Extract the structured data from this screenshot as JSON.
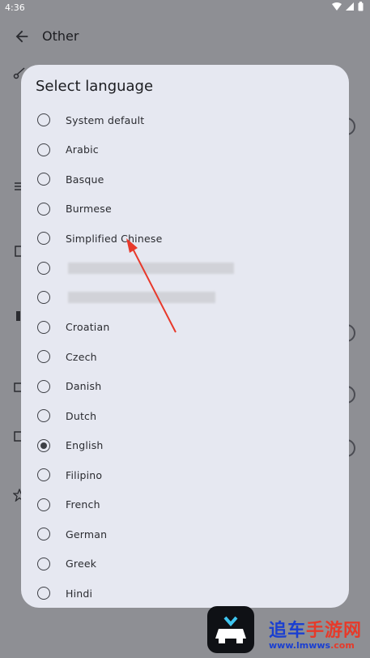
{
  "status_bar": {
    "time": "4:36"
  },
  "app_bar": {
    "title": "Other"
  },
  "dialog": {
    "title": "Select language",
    "options": [
      {
        "label": "System default",
        "checked": false
      },
      {
        "label": "Arabic",
        "checked": false
      },
      {
        "label": "Basque",
        "checked": false
      },
      {
        "label": "Burmese",
        "checked": false
      },
      {
        "label": "Simplified Chinese",
        "checked": false
      },
      {
        "label": "",
        "checked": false,
        "blurred": true
      },
      {
        "label": "",
        "checked": false,
        "blurred": true
      },
      {
        "label": "Croatian",
        "checked": false
      },
      {
        "label": "Czech",
        "checked": false
      },
      {
        "label": "Danish",
        "checked": false
      },
      {
        "label": "Dutch",
        "checked": false
      },
      {
        "label": "English",
        "checked": true
      },
      {
        "label": "Filipino",
        "checked": false
      },
      {
        "label": "French",
        "checked": false
      },
      {
        "label": "German",
        "checked": false
      },
      {
        "label": "Greek",
        "checked": false
      },
      {
        "label": "Hindi",
        "checked": false
      }
    ]
  },
  "watermark": {
    "name_blue": "追车",
    "name_red": "手游网",
    "url_blue": "www.lmwws",
    "url_red": ".com"
  },
  "colors": {
    "accent_arrow": "#e8392b",
    "dialog_bg": "#e6e8f1",
    "scrim": "#8e8f94"
  }
}
